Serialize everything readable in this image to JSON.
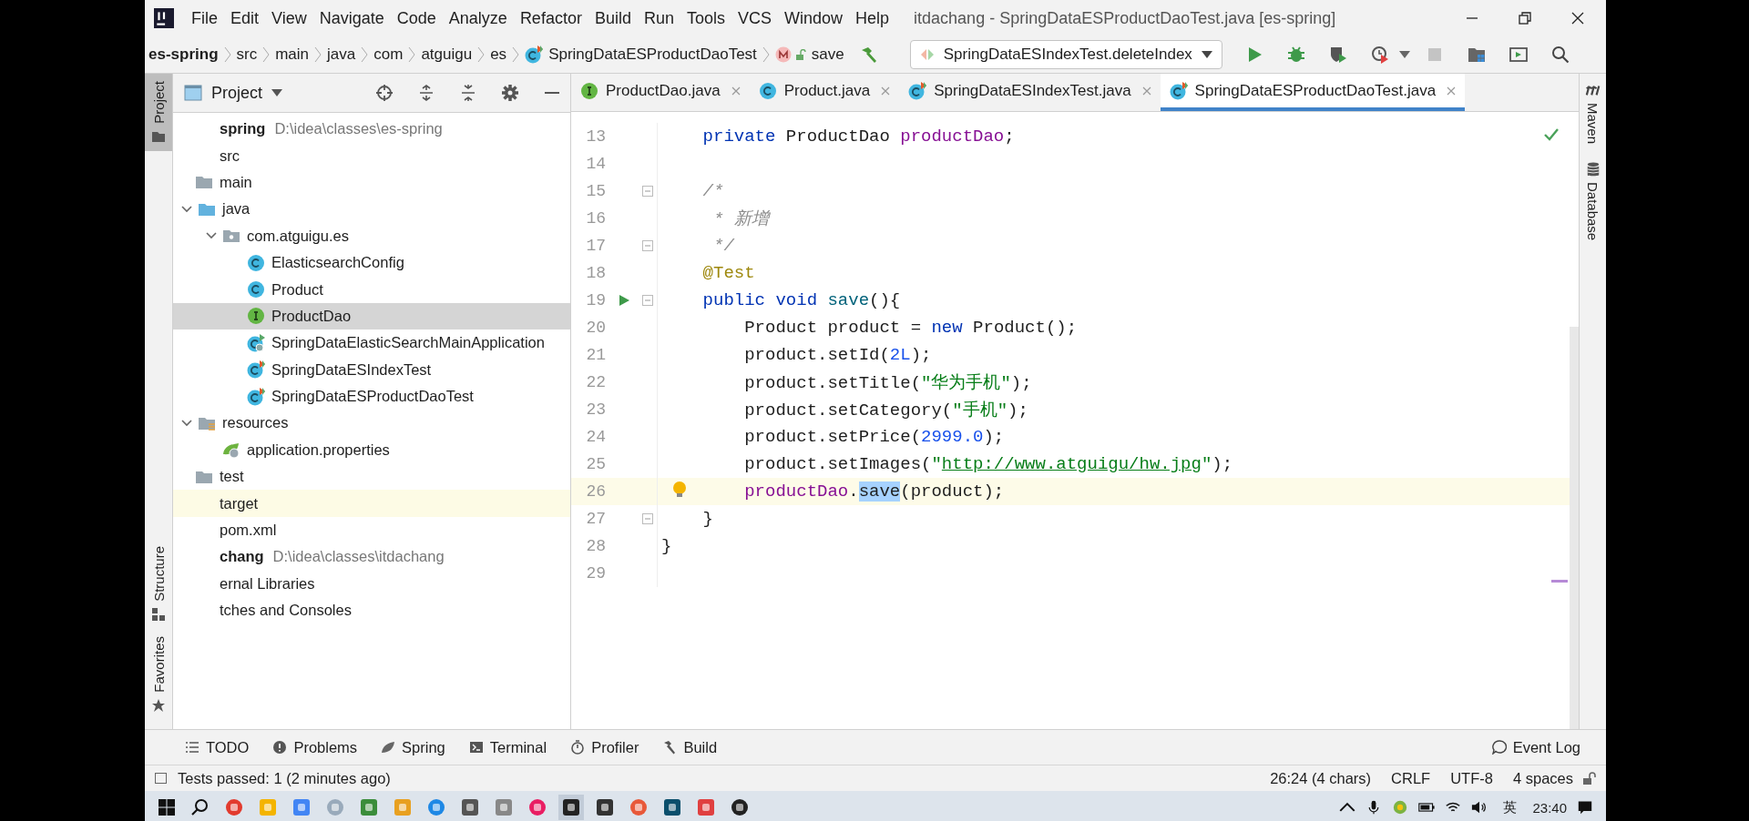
{
  "window": {
    "title": "itdachang - SpringDataESProductDaoTest.java [es-spring]"
  },
  "menu": [
    "File",
    "Edit",
    "View",
    "Navigate",
    "Code",
    "Analyze",
    "Refactor",
    "Build",
    "Run",
    "Tools",
    "VCS",
    "Window",
    "Help"
  ],
  "breadcrumbs": [
    {
      "label": "es-spring",
      "kind": "module"
    },
    {
      "label": "src",
      "kind": "dir"
    },
    {
      "label": "main",
      "kind": "dir"
    },
    {
      "label": "java",
      "kind": "dir"
    },
    {
      "label": "com",
      "kind": "dir"
    },
    {
      "label": "atguigu",
      "kind": "dir"
    },
    {
      "label": "es",
      "kind": "dir"
    },
    {
      "label": "SpringDataESProductDaoTest",
      "kind": "test-class"
    },
    {
      "label": "save",
      "kind": "method"
    }
  ],
  "run_config": {
    "label": "SpringDataESIndexTest.deleteIndex"
  },
  "left_stripe": [
    {
      "label": "Project",
      "selected": true
    },
    {
      "label": "Structure",
      "selected": false
    },
    {
      "label": "Favorites",
      "selected": false
    }
  ],
  "right_stripe": [
    {
      "label": "Maven",
      "kind": "maven"
    },
    {
      "label": "Database",
      "kind": "database"
    }
  ],
  "project_panel": {
    "title": "Project",
    "tree": [
      {
        "label": "spring",
        "kind": "module",
        "path": "D:\\idea\\classes\\es-spring",
        "selected": false,
        "excluded": false,
        "children": [
          {
            "label": "src",
            "selected": false,
            "excluded": false,
            "children": [
              {
                "label": "main",
                "kind": "folder",
                "selected": false,
                "excluded": false,
                "children": [
                  {
                    "label": "java",
                    "kind": "source-folder",
                    "expanded": true,
                    "selected": false,
                    "excluded": false,
                    "children": [
                      {
                        "label": "com.atguigu.es",
                        "kind": "package",
                        "expanded": true,
                        "selected": false,
                        "excluded": false,
                        "children": [
                          {
                            "label": "ElasticsearchConfig",
                            "kind": "class",
                            "selected": false,
                            "excluded": false
                          },
                          {
                            "label": "Product",
                            "kind": "class",
                            "selected": false,
                            "excluded": false
                          },
                          {
                            "label": "ProductDao",
                            "kind": "interface",
                            "selected": true,
                            "excluded": false
                          },
                          {
                            "label": "SpringDataElasticSearchMainApplication",
                            "kind": "app-class",
                            "selected": false,
                            "excluded": false
                          },
                          {
                            "label": "SpringDataESIndexTest",
                            "kind": "test-class",
                            "selected": false,
                            "excluded": false
                          },
                          {
                            "label": "SpringDataESProductDaoTest",
                            "kind": "test-class",
                            "selected": false,
                            "excluded": false
                          }
                        ]
                      }
                    ]
                  },
                  {
                    "label": "resources",
                    "kind": "resources-folder",
                    "expanded": true,
                    "selected": false,
                    "excluded": false,
                    "children": [
                      {
                        "label": "application.properties",
                        "kind": "spring-properties",
                        "selected": false,
                        "excluded": false
                      }
                    ]
                  }
                ]
              },
              {
                "label": "test",
                "kind": "folder",
                "selected": false,
                "excluded": false
              }
            ]
          },
          {
            "label": "target",
            "selected": false,
            "excluded": true
          },
          {
            "label": "pom.xml",
            "selected": false,
            "excluded": false
          }
        ]
      },
      {
        "label": "chang",
        "kind": "module",
        "path": "D:\\idea\\classes\\itdachang",
        "selected": false,
        "excluded": false
      },
      {
        "label": "ernal Libraries",
        "selected": false,
        "excluded": false
      },
      {
        "label": "tches and Consoles",
        "selected": false,
        "excluded": false
      }
    ]
  },
  "tabs": [
    {
      "label": "ProductDao.java",
      "kind": "interface",
      "selected": false
    },
    {
      "label": "Product.java",
      "kind": "class",
      "selected": false
    },
    {
      "label": "SpringDataESIndexTest.java",
      "kind": "test-class",
      "selected": false
    },
    {
      "label": "SpringDataESProductDaoTest.java",
      "kind": "test-class",
      "selected": true
    }
  ],
  "editor": {
    "lines": [
      {
        "number": "13",
        "current": false,
        "run": false,
        "fold": false,
        "bulb": false,
        "tokens": [
          {
            "text": "    private",
            "kind": "keyword"
          },
          {
            "text": " ProductDao ",
            "kind": "plain"
          },
          {
            "text": "productDao",
            "kind": "field"
          },
          {
            "text": ";",
            "kind": "plain"
          }
        ]
      },
      {
        "number": "14",
        "current": false,
        "run": false,
        "fold": false,
        "bulb": false
      },
      {
        "number": "15",
        "current": false,
        "run": false,
        "fold": true,
        "bulb": false,
        "tokens": [
          {
            "text": "    /*",
            "kind": "comment"
          }
        ]
      },
      {
        "number": "16",
        "current": false,
        "run": false,
        "fold": false,
        "bulb": false,
        "tokens": [
          {
            "text": "     * 新增",
            "kind": "comment"
          }
        ]
      },
      {
        "number": "17",
        "current": false,
        "run": false,
        "fold": true,
        "bulb": false,
        "tokens": [
          {
            "text": "     */",
            "kind": "comment"
          }
        ]
      },
      {
        "number": "18",
        "current": false,
        "run": false,
        "fold": false,
        "bulb": false,
        "tokens": [
          {
            "text": "    @Test",
            "kind": "annotation"
          }
        ]
      },
      {
        "number": "19",
        "current": false,
        "run": true,
        "fold": true,
        "bulb": false,
        "tokens": [
          {
            "text": "    public void ",
            "kind": "keyword"
          },
          {
            "text": "save",
            "kind": "method"
          },
          {
            "text": "(){",
            "kind": "plain"
          }
        ]
      },
      {
        "number": "20",
        "current": false,
        "run": false,
        "fold": false,
        "bulb": false,
        "tokens": [
          {
            "text": "        Product product = ",
            "kind": "plain"
          },
          {
            "text": "new",
            "kind": "keyword"
          },
          {
            "text": " Product();",
            "kind": "plain"
          }
        ]
      },
      {
        "number": "21",
        "current": false,
        "run": false,
        "fold": false,
        "bulb": false,
        "tokens": [
          {
            "text": "        product.setId(",
            "kind": "plain"
          },
          {
            "text": "2L",
            "kind": "number"
          },
          {
            "text": ");",
            "kind": "plain"
          }
        ]
      },
      {
        "number": "22",
        "current": false,
        "run": false,
        "fold": false,
        "bulb": false,
        "tokens": [
          {
            "text": "        product.setTitle(",
            "kind": "plain"
          },
          {
            "text": "\"华为手机\"",
            "kind": "string"
          },
          {
            "text": ");",
            "kind": "plain"
          }
        ]
      },
      {
        "number": "23",
        "current": false,
        "run": false,
        "fold": false,
        "bulb": false,
        "tokens": [
          {
            "text": "        product.setCategory(",
            "kind": "plain"
          },
          {
            "text": "\"手机\"",
            "kind": "string"
          },
          {
            "text": ");",
            "kind": "plain"
          }
        ]
      },
      {
        "number": "24",
        "current": false,
        "run": false,
        "fold": false,
        "bulb": false,
        "tokens": [
          {
            "text": "        product.setPrice(",
            "kind": "plain"
          },
          {
            "text": "2999.0",
            "kind": "number"
          },
          {
            "text": ");",
            "kind": "plain"
          }
        ]
      },
      {
        "number": "25",
        "current": false,
        "run": false,
        "fold": false,
        "bulb": false,
        "tokens": [
          {
            "text": "        product.setImages(",
            "kind": "plain"
          },
          {
            "text": "\"",
            "kind": "string"
          },
          {
            "text": "http://www.atguigu/hw.jpg",
            "kind": "url"
          },
          {
            "text": "\"",
            "kind": "string"
          },
          {
            "text": ");",
            "kind": "plain"
          }
        ]
      },
      {
        "number": "26",
        "current": true,
        "run": false,
        "fold": false,
        "bulb": true,
        "tokens": [
          {
            "text": "        productDao",
            "kind": "field"
          },
          {
            "text": ".",
            "kind": "plain"
          },
          {
            "text": "save",
            "kind": "selection"
          },
          {
            "text": "(product);",
            "kind": "plain"
          }
        ]
      },
      {
        "number": "27",
        "current": false,
        "run": false,
        "fold": true,
        "bulb": false,
        "tokens": [
          {
            "text": "    }",
            "kind": "plain"
          }
        ]
      },
      {
        "number": "28",
        "current": false,
        "run": false,
        "fold": false,
        "bulb": false,
        "tokens": [
          {
            "text": "}",
            "kind": "plain"
          }
        ]
      },
      {
        "number": "29",
        "current": false,
        "run": false,
        "fold": false,
        "bulb": false
      }
    ]
  },
  "tool_buttons": [
    {
      "label": "TODO",
      "kind": "list"
    },
    {
      "label": "Problems",
      "kind": "problems"
    },
    {
      "label": "Spring",
      "kind": "spring"
    },
    {
      "label": "Terminal",
      "kind": "terminal"
    },
    {
      "label": "Profiler",
      "kind": "profiler"
    },
    {
      "label": "Build",
      "kind": "build"
    }
  ],
  "event_log": {
    "label": "Event Log"
  },
  "status_bar": {
    "message": "Tests passed: 1 (2 minutes ago)",
    "items": [
      "26:24 (4 chars)",
      "CRLF",
      "UTF-8",
      "4 spaces"
    ]
  },
  "taskbar": {
    "input_method": "英",
    "clock": "23:40"
  }
}
